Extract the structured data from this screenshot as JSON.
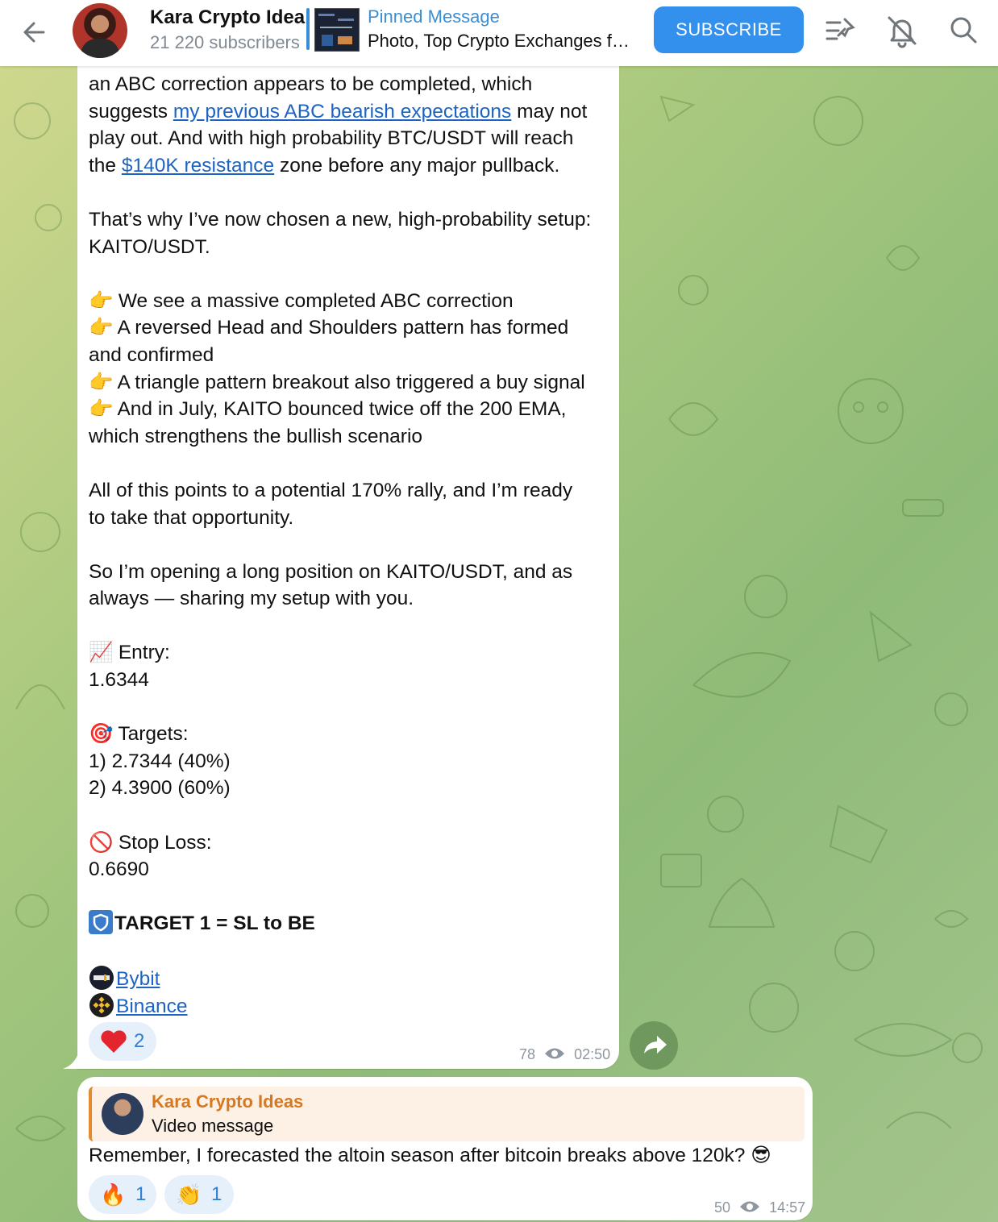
{
  "header": {
    "title": "Kara Crypto Idea",
    "subscribers": "21 220 subscribers",
    "pinned_title": "Pinned Message",
    "pinned_text": "Photo, Top Crypto Exchanges f…",
    "subscribe_label": "SUBSCRIBE"
  },
  "message1": {
    "lines": [
      "an ABC correction appears to be completed, which",
      "suggests ",
      "my previous ABC bearish expectations",
      " may not",
      "play out. And with high probability BTC/USDT will reach",
      "the ",
      "$140K resistance",
      " zone before any major pullback.",
      "That’s why I’ve now chosen a new, high-probability setup:",
      "KAITO/USDT.",
      "We see a massive completed ABC correction",
      "A reversed Head and Shoulders pattern has formed",
      "and confirmed",
      "A triangle pattern breakout also triggered a buy signal",
      "And in July, KAITO bounced twice off the 200 EMA,",
      "which strengthens the bullish scenario",
      "All of this points to a potential 170% rally, and I’m ready",
      "to take that opportunity.",
      "So I’m opening a long position on KAITO/USDT, and as",
      "always — sharing my setup with you.",
      "Entry:",
      "1.6344",
      "Targets:",
      "1) 2.7344 (40%)",
      "2) 4.3900 (60%)",
      "Stop Loss:",
      "0.6690",
      "TARGET 1 = SL to BE",
      "Bybit",
      "Binance"
    ],
    "emojis": {
      "point": "👉",
      "chart": "📈",
      "target": "🎯",
      "stop": "🚫"
    },
    "reaction_count": "2",
    "views": "78",
    "time": "02:50"
  },
  "message2": {
    "reply_name": "Kara Crypto Ideas",
    "reply_text": "Video message",
    "text": "Remember, I forecasted the altoin season after bitcoin breaks above 120k? 😎",
    "reaction1_count": "1",
    "reaction2_count": "1",
    "views": "50",
    "time": "14:57"
  },
  "colors": {
    "accent": "#3390ec",
    "link": "#1d64c2",
    "reply_name": "#d6781f"
  }
}
